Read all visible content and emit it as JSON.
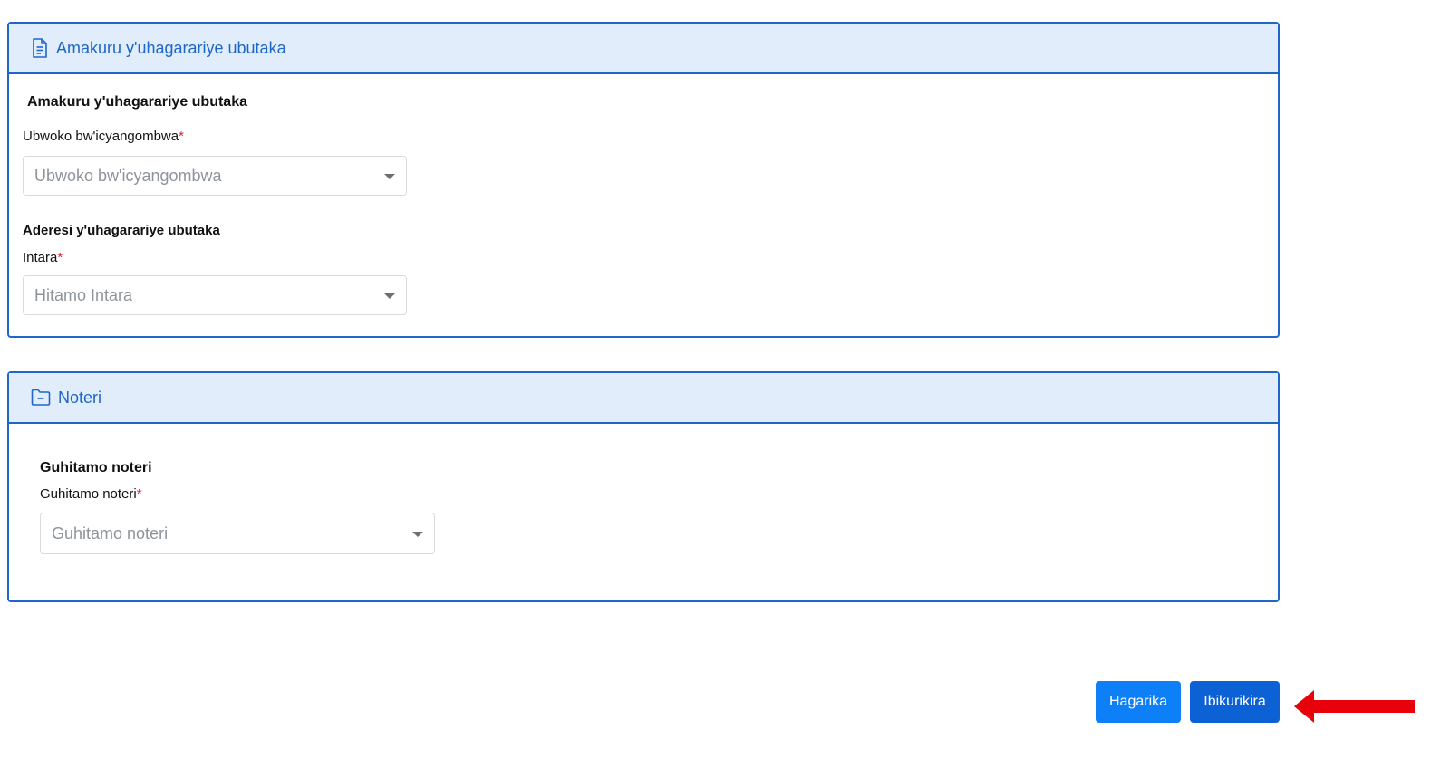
{
  "applicant_panel": {
    "header_title": "Amakuru y'uhagarariye ubutaka",
    "header_icon": "document-icon",
    "section_title": "Amakuru y'uhagarariye ubutaka",
    "relationship_field": {
      "label": "Ubwoko bw'icyangombwa",
      "required": "*",
      "placeholder": "Ubwoko bw'icyangombwa"
    },
    "address_title": "Aderesi y'uhagarariye ubutaka",
    "province_field": {
      "label": "Intara",
      "required": "*",
      "placeholder": "Hitamo Intara"
    }
  },
  "notary_panel": {
    "header_title": "Noteri",
    "header_icon": "folder-minus-icon",
    "section_title": "Guhitamo noteri",
    "notary_field": {
      "label": "Guhitamo noteri",
      "required": "*",
      "placeholder": "Guhitamo noteri"
    }
  },
  "actions": {
    "cancel_label": "Hagarika",
    "confirm_label": "Ibikurikira",
    "arrow_icon": "left-arrow-icon"
  },
  "colors": {
    "accent": "#1f66c9",
    "header_bg": "#e1edfb",
    "required": "#e0202a",
    "cancel_button": "#0d7ff7",
    "confirm_button": "#0c62d4",
    "annotation_arrow": "#e8000b"
  }
}
